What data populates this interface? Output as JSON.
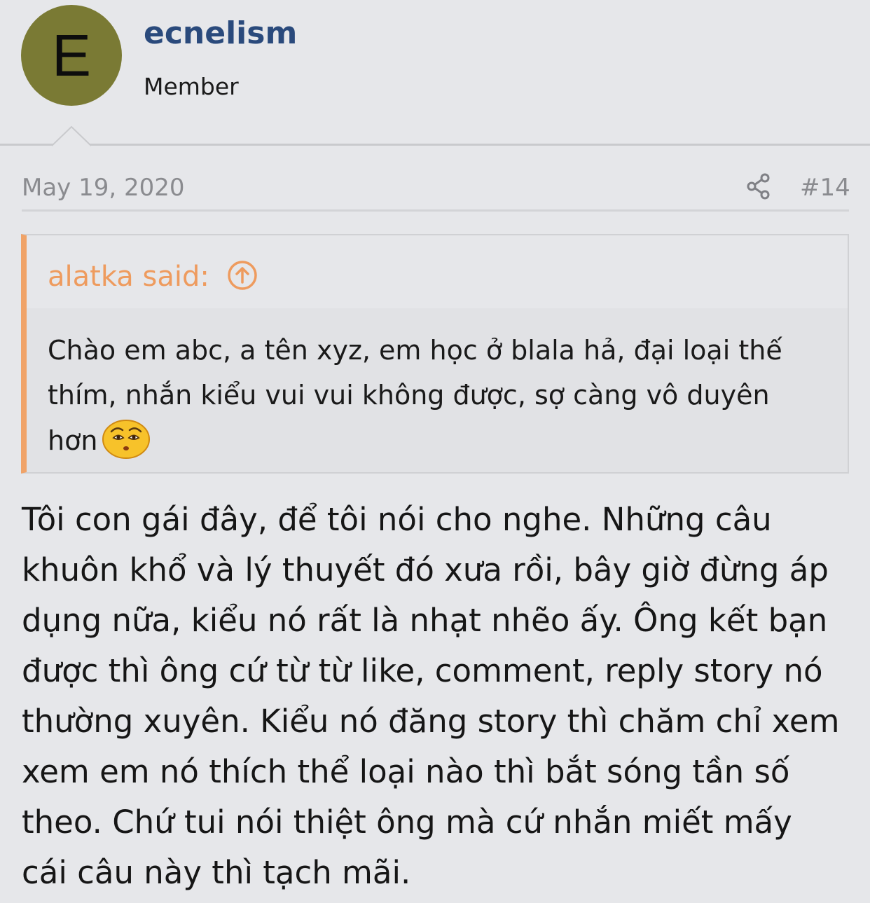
{
  "user": {
    "avatar_letter": "E",
    "username": "ecnelism",
    "title": "Member",
    "avatar_color": "#7a7a34",
    "username_color": "#2a4a7c"
  },
  "meta": {
    "date": "May 19, 2020",
    "post_number": "#14",
    "share_icon": "share-icon"
  },
  "quote": {
    "author_label": "alatka said:",
    "up_icon": "arrow-up-circle-icon",
    "text": "Chào em abc, a tên xyz, em học ở blala hả, đại loại thế\nthím, nhắn kiểu vui vui không được, sợ càng vô duyên\nhơn",
    "emoji": "worried-face-emoji",
    "accent_color": "#f0a368"
  },
  "post": {
    "lines": [
      "Tôi con gái đây, để tôi nói cho nghe. Những câu",
      "khuôn khổ và lý thuyết đó xưa rồi, bây giờ đừng áp",
      "dụng nữa, kiểu nó rất là nhạt nhẽo ấy. Ông kết bạn",
      "được thì ông cứ từ từ like, comment, reply story nó",
      "thường xuyên. Kiểu nó đăng story thì chăm chỉ xem",
      "xem em nó thích thể loại nào thì bắt sóng tần số",
      "theo. Chứ tui nói thiệt ông mà cứ nhắn miết mấy",
      "cái câu này thì tạch mãi."
    ]
  }
}
